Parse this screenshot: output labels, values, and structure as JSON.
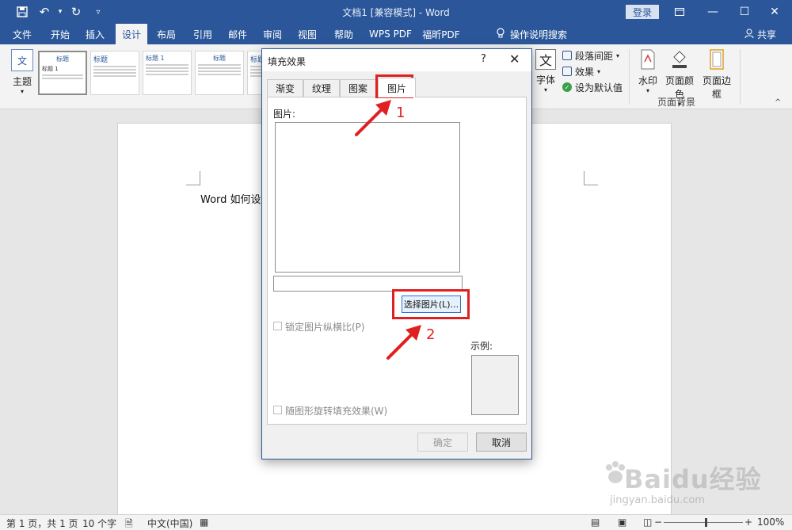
{
  "titlebar": {
    "title": "文档1 [兼容模式] - Word",
    "login": "登录",
    "save_icon": "save-icon",
    "undo_icon": "undo-icon",
    "redo_icon": "redo-icon"
  },
  "tabs": [
    {
      "label": "文件"
    },
    {
      "label": "开始"
    },
    {
      "label": "插入"
    },
    {
      "label": "设计"
    },
    {
      "label": "布局"
    },
    {
      "label": "引用"
    },
    {
      "label": "邮件"
    },
    {
      "label": "审阅"
    },
    {
      "label": "视图"
    },
    {
      "label": "帮助"
    },
    {
      "label": "WPS PDF"
    },
    {
      "label": "福昕PDF"
    }
  ],
  "tellme": "操作说明搜索",
  "share": "共享",
  "ribbon": {
    "theme_label": "主题",
    "theme_icon_text": "文",
    "style_titles": [
      "标题",
      "标题",
      "标题 1",
      "标题",
      "标题",
      "标题"
    ],
    "first_thumb_title": "标题 1",
    "font_label": "字体",
    "font_icon_text": "文",
    "para_spacing": "段落间距",
    "effects": "效果",
    "set_default": "设为默认值",
    "watermark": "水印",
    "page_color": "页面颜色",
    "page_border": "页面边框",
    "page_background_group": "页面背景"
  },
  "document": {
    "text": "Word 如何设置"
  },
  "dialog": {
    "title": "填充效果",
    "help": "?",
    "close": "✕",
    "tabs": [
      {
        "label": "渐变"
      },
      {
        "label": "纹理"
      },
      {
        "label": "图案"
      },
      {
        "label": "图片"
      }
    ],
    "picture_label": "图片:",
    "choose_button": "选择图片(L)...",
    "lock_ratio": "锁定图片纵横比(P)",
    "sample_label": "示例:",
    "rotate_with_shape": "随图形旋转填充效果(W)",
    "ok": "确定",
    "cancel": "取消"
  },
  "annotations": {
    "num1": "1",
    "num2": "2",
    "color": "#e02020"
  },
  "statusbar": {
    "page": "第 1 页，共 1 页",
    "words": "10 个字",
    "lang": "中文(中国)",
    "zoom": "100%"
  },
  "watermark": {
    "main": "Baidu经验",
    "sub": "jingyan.baidu.com"
  },
  "colors": {
    "brand": "#2b579a",
    "highlight": "#e02020"
  }
}
